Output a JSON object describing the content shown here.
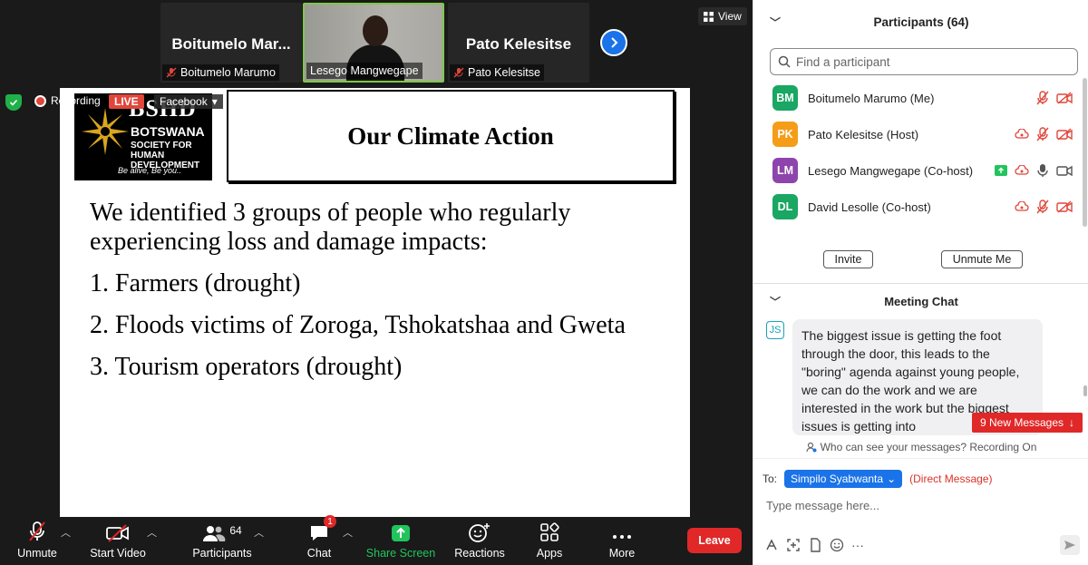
{
  "top_strip": {
    "tiles": [
      {
        "big_name": "Boitumelo  Mar...",
        "label": "Boitumelo Marumo"
      },
      {
        "label": "Lesego Mangwegape"
      },
      {
        "big_name": "Pato Kelesitse",
        "label": "Pato Kelesitse"
      }
    ],
    "view_label": "View"
  },
  "status": {
    "recording": "Recording",
    "live": "LIVE",
    "stream": "Facebook"
  },
  "slide": {
    "logo": {
      "abbr": "BSHD",
      "line1": "BOTSWANA",
      "line2": "SOCIETY FOR HUMAN",
      "line3": "DEVELOPMENT",
      "tagline": "Be alive, Be you.."
    },
    "title": "Our Climate Action",
    "intro": "We identified 3 groups of people who regularly experiencing loss and damage impacts:",
    "items": [
      "1. Farmers (drought)",
      "2. Floods victims of Zoroga, Tshokatshaa and Gweta",
      "3. Tourism operators (drought)"
    ]
  },
  "toolbar": {
    "unmute": "Unmute",
    "start_video": "Start Video",
    "participants": "Participants",
    "participants_count": "64",
    "chat": "Chat",
    "chat_badge": "1",
    "share": "Share Screen",
    "reactions": "Reactions",
    "apps": "Apps",
    "more": "More",
    "leave": "Leave"
  },
  "participants_panel": {
    "title": "Participants (64)",
    "search_placeholder": "Find a participant",
    "list": [
      {
        "initials": "BM",
        "name": "Boitumelo Marumo (Me)",
        "color": "#1aa663"
      },
      {
        "initials": "PK",
        "name": "Pato Kelesitse (Host)",
        "color": "#f59d18"
      },
      {
        "initials": "LM",
        "name": "Lesego Mangwegape (Co-host)",
        "color": "#8e44ad"
      },
      {
        "initials": "DL",
        "name": "David Lesolle (Co-host)",
        "color": "#1aa663"
      }
    ],
    "invite": "Invite",
    "unmute_me": "Unmute Me"
  },
  "chat_panel": {
    "title": "Meeting Chat",
    "sender_initials": "JS",
    "message": "The biggest issue is getting the foot through the door, this leads to the \"boring\" agenda against young people, we can do the work and we are interested in the work but the biggest issues is getting into",
    "new_messages": "9 New Messages",
    "visibility": "Who can see your messages? Recording On",
    "to_label": "To:",
    "recipient": "Simpilo Syabwanta",
    "direct": "(Direct Message)",
    "input_placeholder": "Type message here..."
  },
  "colors": {
    "accent": "#1a73e8",
    "leave": "#e02828",
    "share": "#21c45c"
  }
}
